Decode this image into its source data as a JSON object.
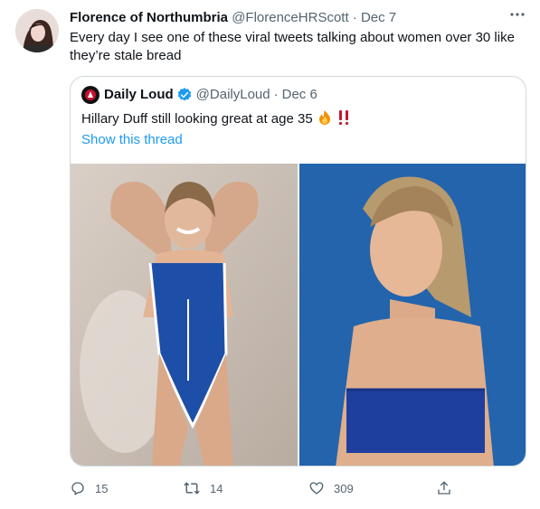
{
  "tweet": {
    "author_name": "Florence of Northumbria",
    "author_handle": "@FlorenceHRScott",
    "separator": "·",
    "date": "Dec 7",
    "text": "Every day I see one of these viral tweets talking about women over 30 like they’re stale bread",
    "more_icon": "more-icon"
  },
  "quoted": {
    "author_name": "Daily Loud",
    "author_handle": "@DailyLoud",
    "separator": "·",
    "date": "Dec 6",
    "text": "Hillary Duff still looking great at age 35",
    "show_thread": "Show this thread",
    "verified_color": "#1d9bf0"
  },
  "actions": {
    "replies": "15",
    "retweets": "14",
    "likes": "309"
  },
  "colors": {
    "accent": "#1d9bf0",
    "muted": "#536471",
    "border": "#cfd9de"
  }
}
